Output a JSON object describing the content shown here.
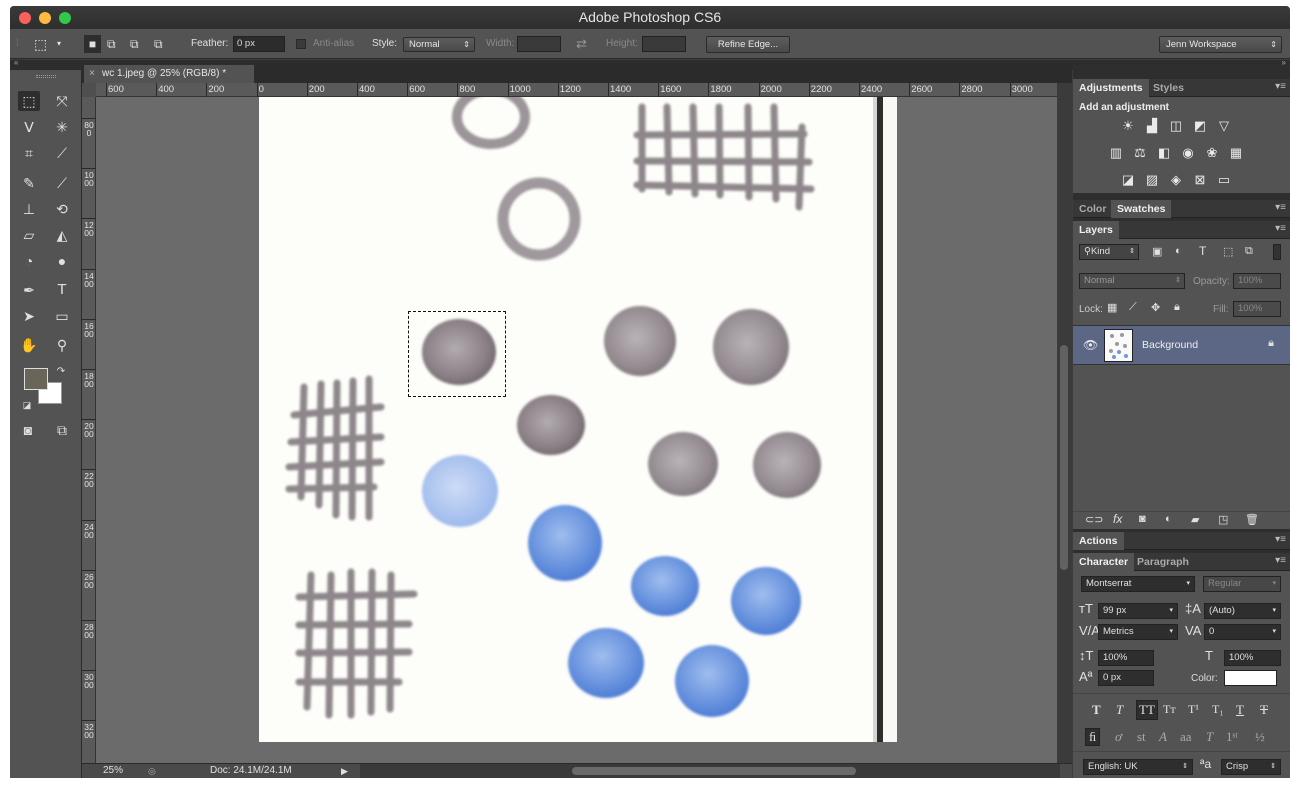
{
  "window": {
    "title": "Adobe Photoshop CS6"
  },
  "options": {
    "feather_label": "Feather:",
    "feather_value": "0 px",
    "antialias_label": "Anti-alias",
    "style_label": "Style:",
    "style_value": "Normal",
    "width_label": "Width:",
    "height_label": "Height:",
    "refine_edge": "Refine Edge...",
    "workspace": "Jenn Workspace"
  },
  "document": {
    "tab_title": "wc 1.jpeg @ 25% (RGB/8) *",
    "zoom": "25%",
    "doc_size": "Doc: 24.1M/24.1M"
  },
  "rulers": {
    "top": [
      "600",
      "400",
      "200",
      "0",
      "200",
      "400",
      "600",
      "800",
      "1000",
      "1200",
      "1400",
      "1600",
      "1800",
      "2000",
      "2200",
      "2400",
      "2600",
      "2800",
      "3000"
    ],
    "left": [
      "800",
      "1000",
      "1200",
      "1400",
      "1600",
      "1800",
      "2000",
      "2200",
      "2400",
      "2600",
      "2800",
      "3000",
      "3200"
    ]
  },
  "panels": {
    "adjustments_tab": "Adjustments",
    "styles_tab": "Styles",
    "add_adjustment": "Add an adjustment",
    "color_tab": "Color",
    "swatches_tab": "Swatches",
    "layers_tab": "Layers",
    "kind": "Kind",
    "blend_mode": "Normal",
    "opacity_label": "Opacity:",
    "opacity_value": "100%",
    "lock_label": "Lock:",
    "fill_label": "Fill:",
    "fill_value": "100%",
    "layer_name": "Background",
    "actions_tab": "Actions",
    "character_tab": "Character",
    "paragraph_tab": "Paragraph",
    "font_family": "Montserrat",
    "font_style": "Regular",
    "font_size": "99 px",
    "leading": "(Auto)",
    "kerning": "Metrics",
    "tracking": "0",
    "vscale": "100%",
    "hscale": "100%",
    "baseline": "0 px",
    "color_label": "Color:",
    "language": "English: UK",
    "aa_icon": "ªa",
    "antialias_mode": "Crisp"
  }
}
